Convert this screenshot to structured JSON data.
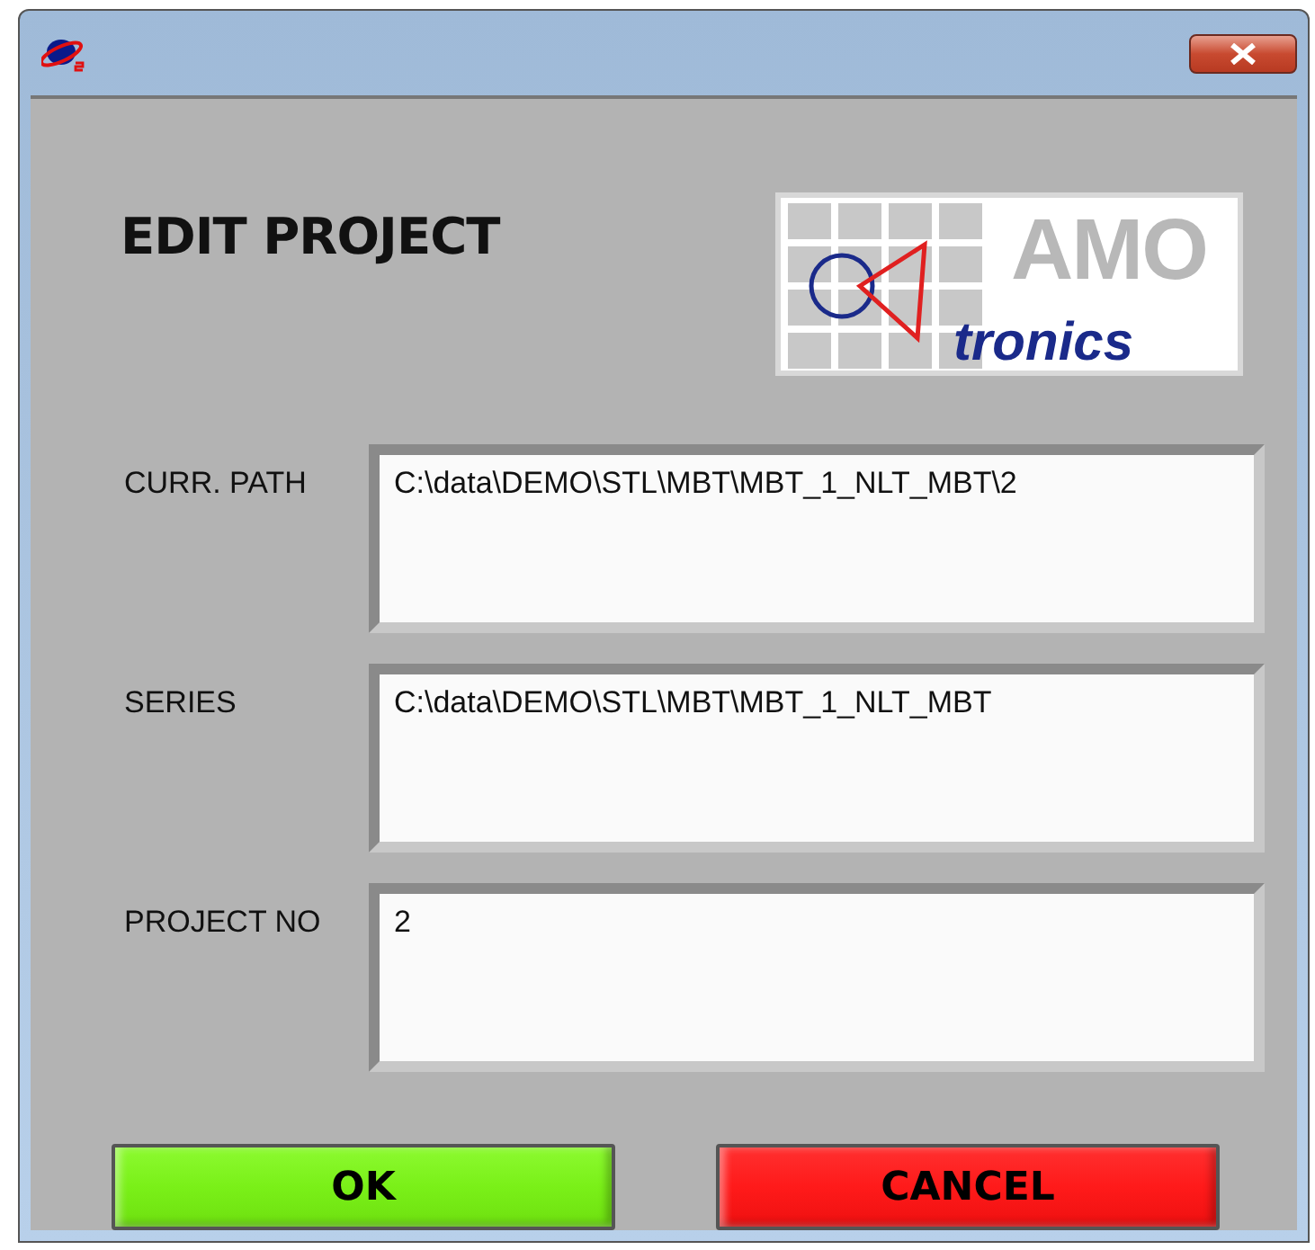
{
  "heading": "EDIT PROJECT",
  "logo": {
    "top": "AMO",
    "bottom": "tronics"
  },
  "fields": [
    {
      "label": "CURR. PATH",
      "value": "C:\\data\\DEMO\\STL\\MBT\\MBT_1_NLT_MBT\\2"
    },
    {
      "label": "SERIES",
      "value": "C:\\data\\DEMO\\STL\\MBT\\MBT_1_NLT_MBT"
    },
    {
      "label": "PROJECT NO",
      "value": "2"
    }
  ],
  "buttons": [
    {
      "label": "OK",
      "kind": "ok"
    },
    {
      "label": "CANCEL",
      "kind": "cancel"
    }
  ]
}
